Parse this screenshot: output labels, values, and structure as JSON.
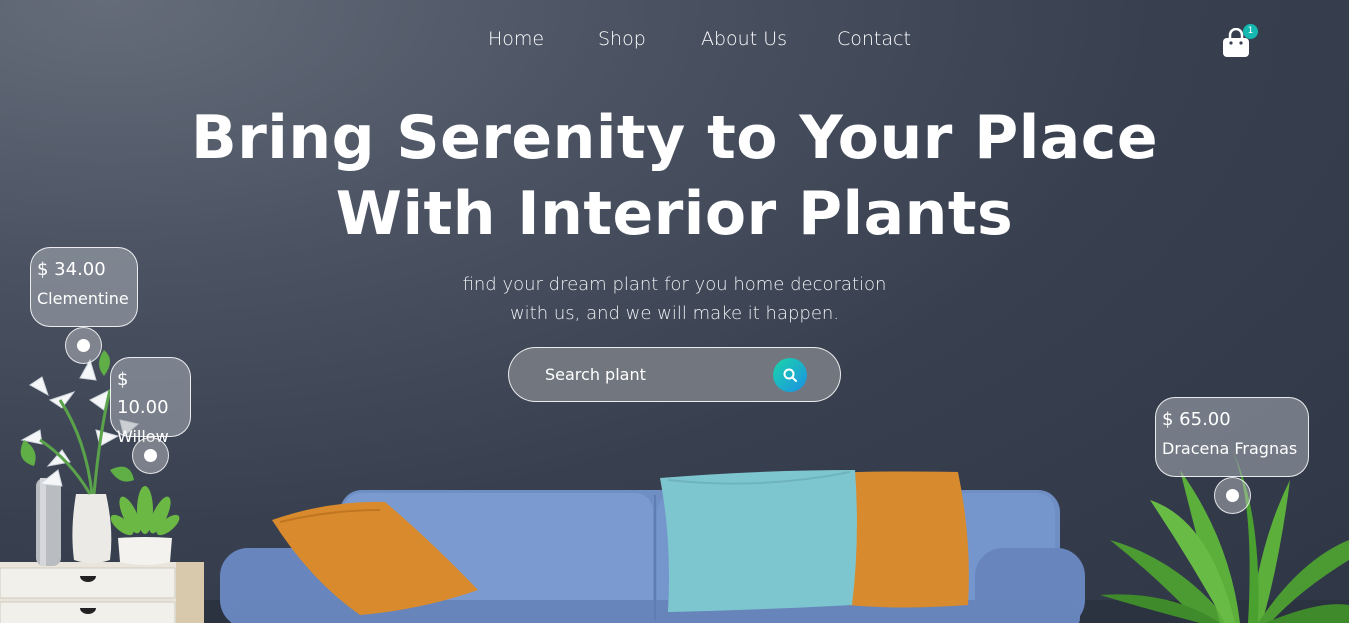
{
  "nav": {
    "items": [
      {
        "label": "Home"
      },
      {
        "label": "Shop"
      },
      {
        "label": "About Us"
      },
      {
        "label": "Contact"
      }
    ],
    "cart_count": "1"
  },
  "hero": {
    "title_line1": "Bring Serenity to Your Place",
    "title_line2": "With Interior Plants",
    "subtitle_line1": "find your dream plant for you home decoration",
    "subtitle_line2": "with us, and we will make it happen."
  },
  "search": {
    "placeholder": "Search plant"
  },
  "products": [
    {
      "price": "$ 34.00",
      "name": "Clementine"
    },
    {
      "price": "$ 10.00",
      "name": "Willow"
    },
    {
      "price": "$ 65.00",
      "name": "Dracena Fragnas"
    }
  ],
  "colors": {
    "accent_start": "#19d6a8",
    "accent_end": "#1d8fe6",
    "background": "#384050"
  },
  "icons": [
    "shopping-bag-icon",
    "search-icon"
  ]
}
